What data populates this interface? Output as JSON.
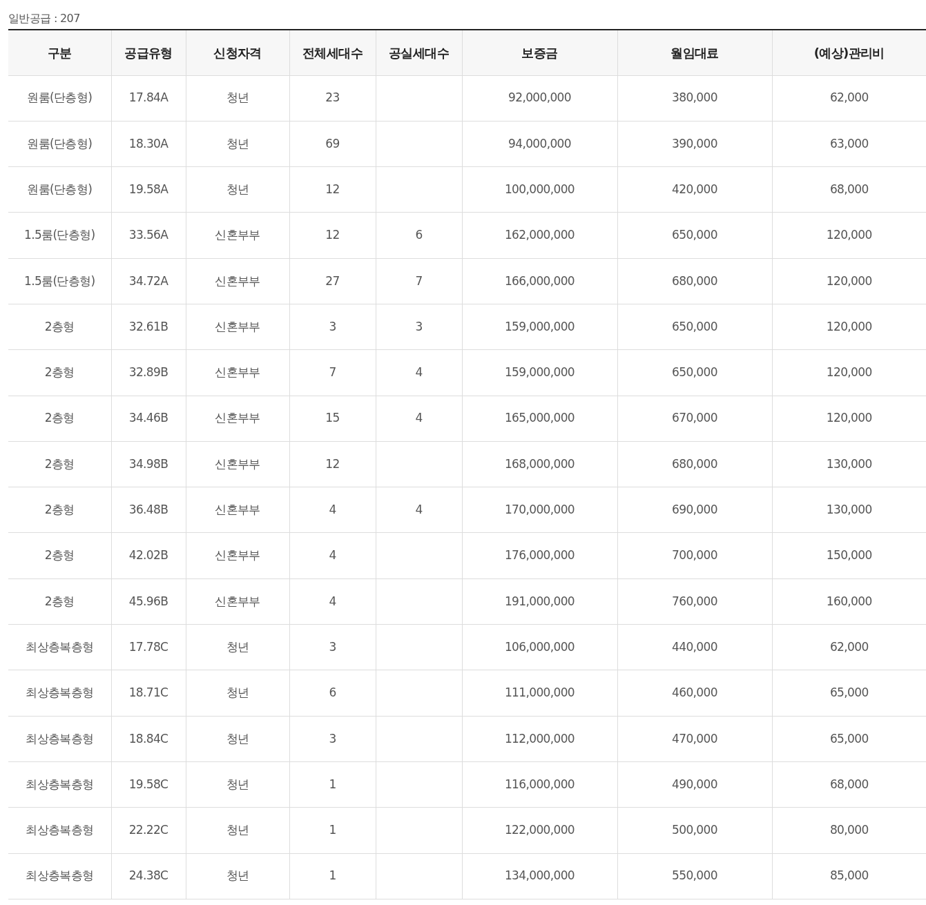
{
  "caption": "일반공급 : 207",
  "table": {
    "columns": [
      "구분",
      "공급유형",
      "신청자격",
      "전체세대수",
      "공실세대수",
      "보증금",
      "월임대료",
      "(예상)관리비"
    ],
    "rows": [
      [
        "원룸(단층형)",
        "17.84A",
        "청년",
        "23",
        null,
        "92,000,000",
        "380,000",
        "62,000"
      ],
      [
        "원룸(단층형)",
        "18.30A",
        "청년",
        "69",
        null,
        "94,000,000",
        "390,000",
        "63,000"
      ],
      [
        "원룸(단층형)",
        "19.58A",
        "청년",
        "12",
        null,
        "100,000,000",
        "420,000",
        "68,000"
      ],
      [
        "1.5룸(단층형)",
        "33.56A",
        "신혼부부",
        "12",
        "6",
        "162,000,000",
        "650,000",
        "120,000"
      ],
      [
        "1.5룸(단층형)",
        "34.72A",
        "신혼부부",
        "27",
        "7",
        "166,000,000",
        "680,000",
        "120,000"
      ],
      [
        "2층형",
        "32.61B",
        "신혼부부",
        "3",
        "3",
        "159,000,000",
        "650,000",
        "120,000"
      ],
      [
        "2층형",
        "32.89B",
        "신혼부부",
        "7",
        "4",
        "159,000,000",
        "650,000",
        "120,000"
      ],
      [
        "2층형",
        "34.46B",
        "신혼부부",
        "15",
        "4",
        "165,000,000",
        "670,000",
        "120,000"
      ],
      [
        "2층형",
        "34.98B",
        "신혼부부",
        "12",
        null,
        "168,000,000",
        "680,000",
        "130,000"
      ],
      [
        "2층형",
        "36.48B",
        "신혼부부",
        "4",
        "4",
        "170,000,000",
        "690,000",
        "130,000"
      ],
      [
        "2층형",
        "42.02B",
        "신혼부부",
        "4",
        null,
        "176,000,000",
        "700,000",
        "150,000"
      ],
      [
        "2층형",
        "45.96B",
        "신혼부부",
        "4",
        null,
        "191,000,000",
        "760,000",
        "160,000"
      ],
      [
        "최상층복층형",
        "17.78C",
        "청년",
        "3",
        null,
        "106,000,000",
        "440,000",
        "62,000"
      ],
      [
        "최상층복층형",
        "18.71C",
        "청년",
        "6",
        null,
        "111,000,000",
        "460,000",
        "65,000"
      ],
      [
        "최상층복층형",
        "18.84C",
        "청년",
        "3",
        null,
        "112,000,000",
        "470,000",
        "65,000"
      ],
      [
        "최상층복층형",
        "19.58C",
        "청년",
        "1",
        null,
        "116,000,000",
        "490,000",
        "68,000"
      ],
      [
        "최상층복층형",
        "22.22C",
        "청년",
        "1",
        null,
        "122,000,000",
        "500,000",
        "80,000"
      ],
      [
        "최상층복층형",
        "24.38C",
        "청년",
        "1",
        null,
        "134,000,000",
        "550,000",
        "85,000"
      ]
    ]
  }
}
